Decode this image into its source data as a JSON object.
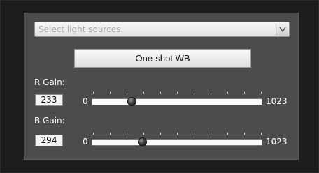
{
  "light_source": {
    "placeholder": "Select light sources."
  },
  "oneshot_button": {
    "label": "One-shot WB"
  },
  "r_gain": {
    "label": "R Gain:",
    "value": "233",
    "min": "0",
    "max": "1023",
    "level": 233
  },
  "b_gain": {
    "label": "B Gain:",
    "value": "294",
    "min": "0",
    "max": "1023",
    "level": 294
  },
  "icons": {
    "dropdown": "chevron-down-icon",
    "thumb": "slider-thumb"
  }
}
